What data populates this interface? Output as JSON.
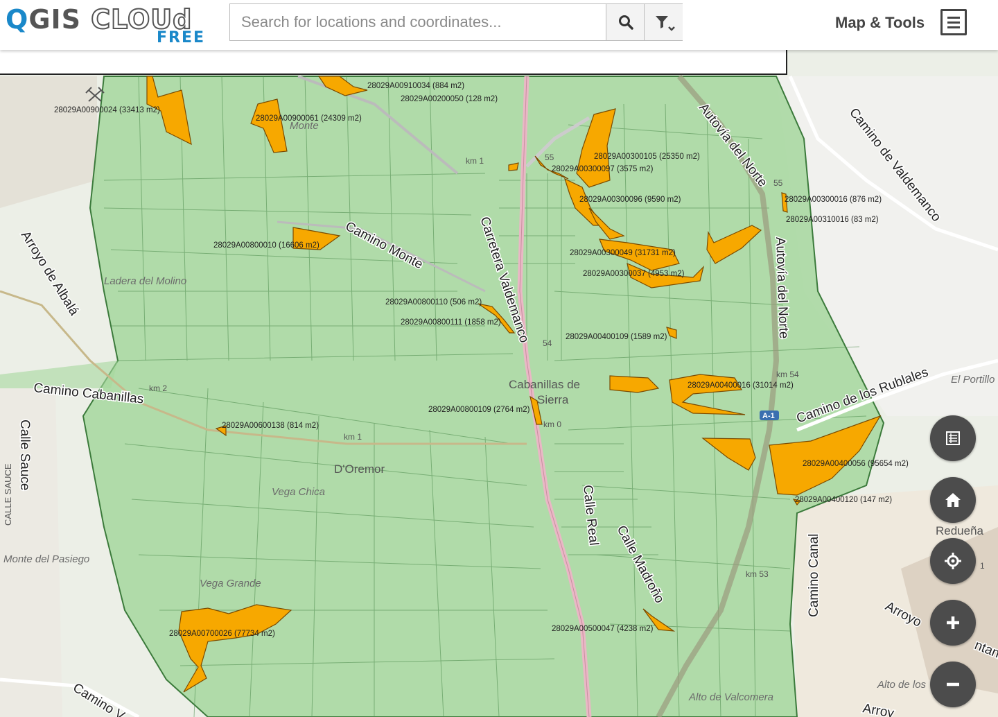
{
  "app": {
    "logo_main": "QGIS CLOUd",
    "logo_q": "Q",
    "logo_gis": "GIS ",
    "logo_cloud": "CLOUd",
    "logo_sub": "FREE",
    "menu_label": "Map & Tools"
  },
  "search": {
    "placeholder": "Search for locations and coordinates...",
    "value": ""
  },
  "icons": {
    "search": "search-icon",
    "filter": "filter-icon",
    "menu": "hamburger-menu-icon",
    "legend": "legend-list-icon",
    "home": "home-icon",
    "locate": "locate-crosshair-icon",
    "zoom_in": "zoom-in-plus-icon",
    "zoom_out": "zoom-out-minus-icon"
  },
  "colors": {
    "parcel_fill": "#f7a800",
    "zone_fill": "#a6d79e",
    "zone_stroke": "#3b7a3b",
    "brand_blue": "#1a88c9",
    "button": "#4c4c4c"
  },
  "parcels": [
    "28029A00910034 (884 m2)",
    "28029A00200050 (128 m2)",
    "28029A00900024 (33413 m2)",
    "28029A00900061 (24309 m2)",
    "28029A00300105 (25350 m2)",
    "28029A00300097 (3575 m2)",
    "28029A00300096 (9590 m2)",
    "28029A00300016 (876 m2)",
    "28029A00310016 (83 m2)",
    "28029A00800010 (16606 m2)",
    "28029A00300049 (31731 m2)",
    "28029A00300037 (4953 m2)",
    "28029A00800110 (506 m2)",
    "28029A00800111 (1858 m2)",
    "28029A00400109 (1589 m2)",
    "28029A00400016 (31014 m2)",
    "28029A00800109 (2764 m2)",
    "28029A00600138 (814 m2)",
    "28029A00400056 (95654 m2)",
    "28029A00400120 (147 m2)",
    "28029A00700026 (77734 m2)",
    "28029A00500047 (4238 m2)"
  ],
  "roads": [
    "Autovía del Norte",
    "Camino de Valdemanco",
    "Arroyo de Albalá",
    "Camino Monte",
    "Carretera Valdemanco",
    "Autovía del Norte",
    "Camino Cabanillas",
    "Camino de los Rublales",
    "Calle Sauce",
    "CALLE SAUCE",
    "Calle Real",
    "Calle Madroño",
    "Camino Canal",
    "Arroyo",
    "Camino V",
    "Arroy",
    "ntanill",
    "El Portillo"
  ],
  "places": [
    "Ladera del Molino",
    "Cabanillas de",
    "Sierra",
    "D'Oremor",
    "Vega Chica",
    "Monte del Pasiego",
    "Vega Grande",
    "Redueña",
    "Alto de los",
    "Alto de Valcomera",
    "Monte"
  ],
  "km_marks": [
    "km 1",
    "km 2",
    "km 1",
    "55",
    "55",
    "km 54",
    "54",
    "km 53",
    "A-1",
    "1",
    "km 0"
  ]
}
